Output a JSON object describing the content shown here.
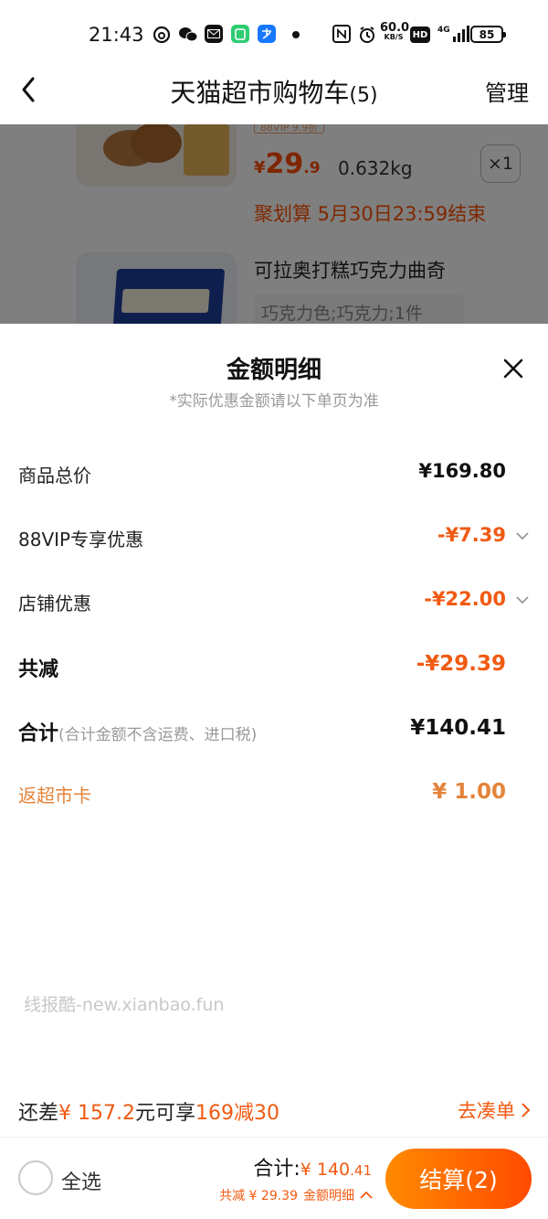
{
  "status_bar": {
    "time": "21:43",
    "speed_value": "60.0",
    "speed_unit": "KB/S",
    "hd": "HD",
    "network": "4G",
    "battery": "85"
  },
  "header": {
    "title": "天猫超市购物车",
    "count": "(5)",
    "manage_label": "管理"
  },
  "cart_background": {
    "item1": {
      "vip_tag": "88VIP 9.9折",
      "price_symbol": "¥",
      "price_int": "29",
      "price_dec": ".9",
      "weight": "0.632kg",
      "quantity": "×1",
      "promo": "聚划算 5月30日23:59结束"
    },
    "item2": {
      "name": "可拉奥打糕巧克力曲奇",
      "spec": "巧克力色;巧克力;1件"
    }
  },
  "sheet": {
    "title": "金额明细",
    "subtitle": "*实际优惠金额请以下单页为准",
    "rows": [
      {
        "label": "商品总价",
        "value": "¥169.80"
      },
      {
        "label": "88VIP专享优惠",
        "value": "-¥7.39"
      },
      {
        "label": "店铺优惠",
        "value": "-¥22.00"
      },
      {
        "label": "共减",
        "value": "-¥29.39"
      },
      {
        "label": "合计",
        "note": "(合计金额不含运费、进口税)",
        "value": "¥140.41"
      },
      {
        "label": "返超市卡",
        "value": "¥ 1.00"
      }
    ],
    "watermark": "线报酷-new.xianbao.fun",
    "promo": {
      "prefix": "还差",
      "amount": "¥ 157.2",
      "middle": "元可享",
      "deal": "169减30",
      "link": "去凑单"
    }
  },
  "bottom_bar": {
    "select_all": "全选",
    "total_label": "合计:",
    "total_symbol": "¥ ",
    "total_int": "140",
    "total_dec": ".41",
    "discount": "共减 ¥ 29.39",
    "detail_label": "金额明细",
    "checkout_label": "结算(2)"
  },
  "colors": {
    "accent": "#f25a12",
    "orange_light": "#e4843b",
    "checkout_start": "#ff8a00",
    "checkout_end": "#ff4a00"
  }
}
